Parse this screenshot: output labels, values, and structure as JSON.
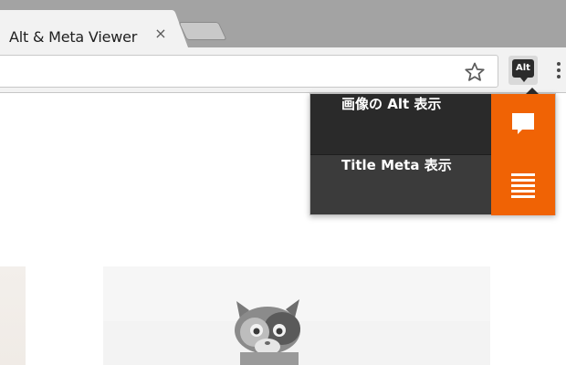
{
  "browser": {
    "tab": {
      "title": "Alt & Meta Viewer",
      "close_glyph": "×"
    },
    "new_tab": {
      "icon": "new-tab-icon"
    },
    "toolbar": {
      "bookmark_icon": "star-icon",
      "extension": {
        "icon_text": "Alt",
        "icon": "chat-bubble-icon"
      },
      "menu_icon": "vertical-dots-icon"
    }
  },
  "popup": {
    "items": [
      {
        "label": "画像の Alt 表示",
        "icon": "comment-icon"
      },
      {
        "label": "Title Meta 表示",
        "icon": "list-icon"
      }
    ],
    "accent": "#f06305"
  }
}
